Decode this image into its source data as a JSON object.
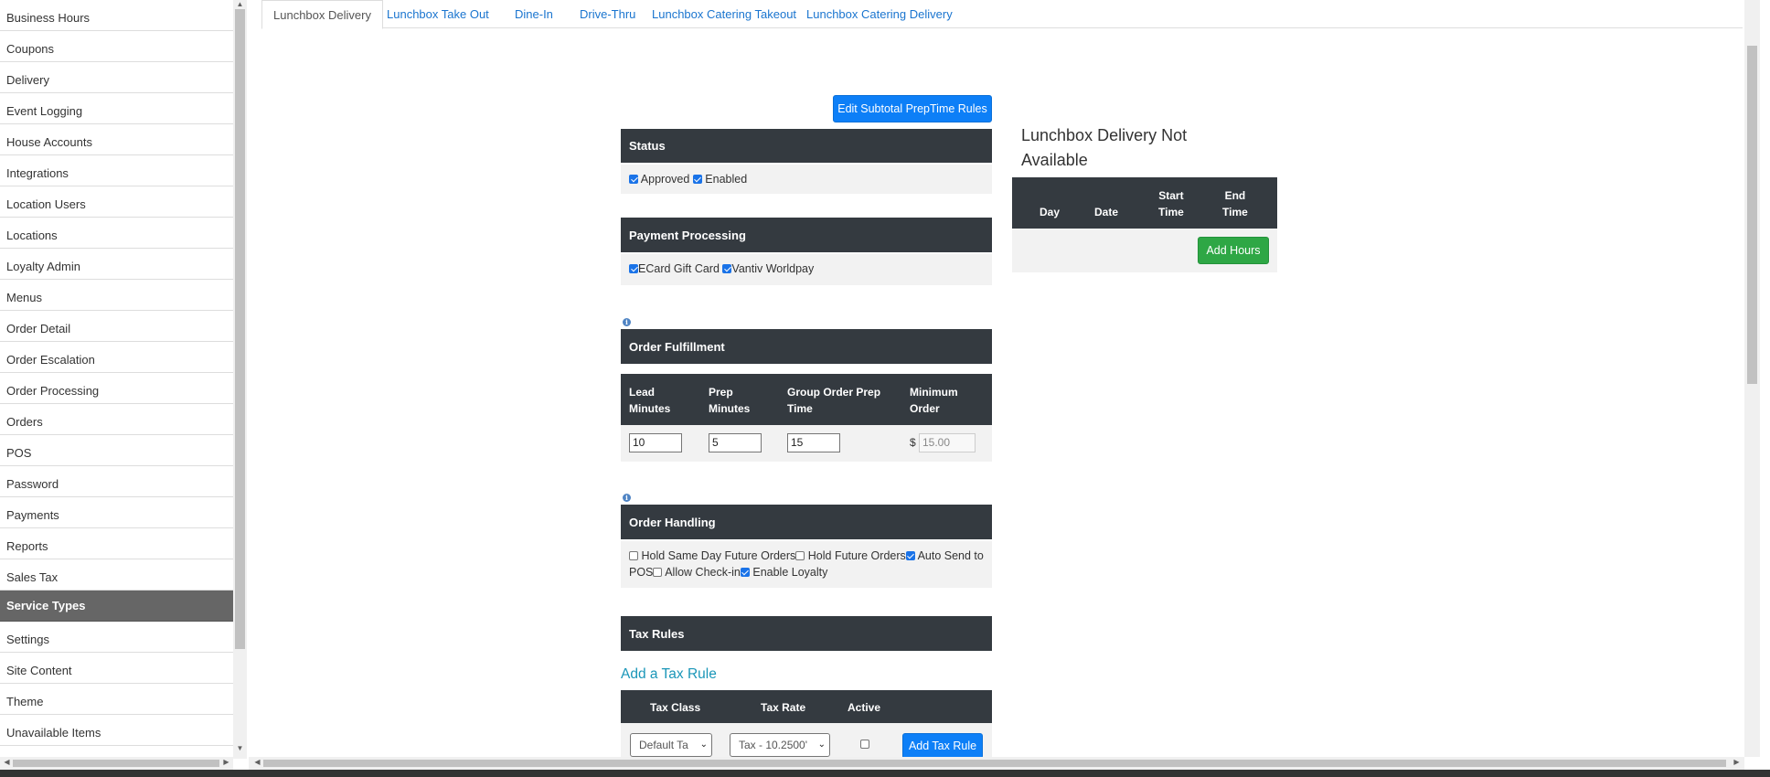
{
  "sidebar": {
    "items": [
      {
        "label": "Business Hours"
      },
      {
        "label": "Coupons"
      },
      {
        "label": "Delivery"
      },
      {
        "label": "Event Logging"
      },
      {
        "label": "House Accounts"
      },
      {
        "label": "Integrations"
      },
      {
        "label": "Location Users"
      },
      {
        "label": "Locations"
      },
      {
        "label": "Loyalty Admin"
      },
      {
        "label": "Menus"
      },
      {
        "label": "Order Detail"
      },
      {
        "label": "Order Escalation"
      },
      {
        "label": "Order Processing"
      },
      {
        "label": "Orders"
      },
      {
        "label": "POS"
      },
      {
        "label": "Password"
      },
      {
        "label": "Payments"
      },
      {
        "label": "Reports"
      },
      {
        "label": "Sales Tax"
      },
      {
        "label": "Service Types",
        "active": true
      },
      {
        "label": "Settings"
      },
      {
        "label": "Site Content"
      },
      {
        "label": "Theme"
      },
      {
        "label": "Unavailable Items"
      }
    ]
  },
  "tabs": [
    {
      "label": "Lunchbox Delivery",
      "active": true
    },
    {
      "label": "Lunchbox Take Out"
    },
    {
      "label": "Dine-In"
    },
    {
      "label": "Drive-Thru"
    },
    {
      "label": "Lunchbox Catering Takeout"
    },
    {
      "label": "Lunchbox Catering Delivery"
    }
  ],
  "edit_rules_button": "Edit Subtotal PrepTime Rules",
  "status": {
    "title": "Status",
    "approved_label": "Approved",
    "approved": true,
    "enabled_label": "Enabled",
    "enabled": true
  },
  "payment": {
    "title": "Payment Processing",
    "ecard_label": "ECard Gift Card",
    "ecard": true,
    "vantiv_label": "Vantiv Worldpay",
    "vantiv": true
  },
  "fulfillment": {
    "title": "Order Fulfillment",
    "headers": [
      "Lead\nMinutes",
      "Prep\nMinutes",
      "Group Order Prep\nTime",
      "Minimum\nOrder"
    ],
    "lead_minutes": "10",
    "prep_minutes": "5",
    "group_prep_time": "15",
    "currency": "$",
    "minimum_order": "15.00"
  },
  "handling": {
    "title": "Order Handling",
    "hold_same_day_label": "Hold Same Day Future Orders",
    "hold_same_day": false,
    "hold_future_label": "Hold Future Orders",
    "hold_future": false,
    "auto_send_label": "Auto Send to POS",
    "auto_send": true,
    "allow_checkin_label": "Allow Check-in",
    "allow_checkin": false,
    "loyalty_label": "Enable Loyalty",
    "loyalty": true
  },
  "tax": {
    "title": "Tax Rules",
    "add_link": "Add a Tax Rule",
    "headers": [
      "Tax Class",
      "Tax Rate",
      "Active"
    ],
    "tax_class_value": "Default Ta",
    "tax_rate_value": "Tax - 10.2500'",
    "add_button": "Add Tax Rule"
  },
  "unavailable": {
    "title_line1": "Lunchbox Delivery Not",
    "title_line2": "Available",
    "headers": [
      "Day",
      "Date",
      "Start\nTime",
      "End\nTime"
    ],
    "add_button": "Add Hours"
  },
  "colors": {
    "header_dark": "#343a40",
    "link_blue": "#1a75cf",
    "button_blue": "#0d7ff7",
    "button_green": "#2ea745",
    "sidebar_active": "#666666",
    "panel_bg": "#f2f2f2"
  }
}
